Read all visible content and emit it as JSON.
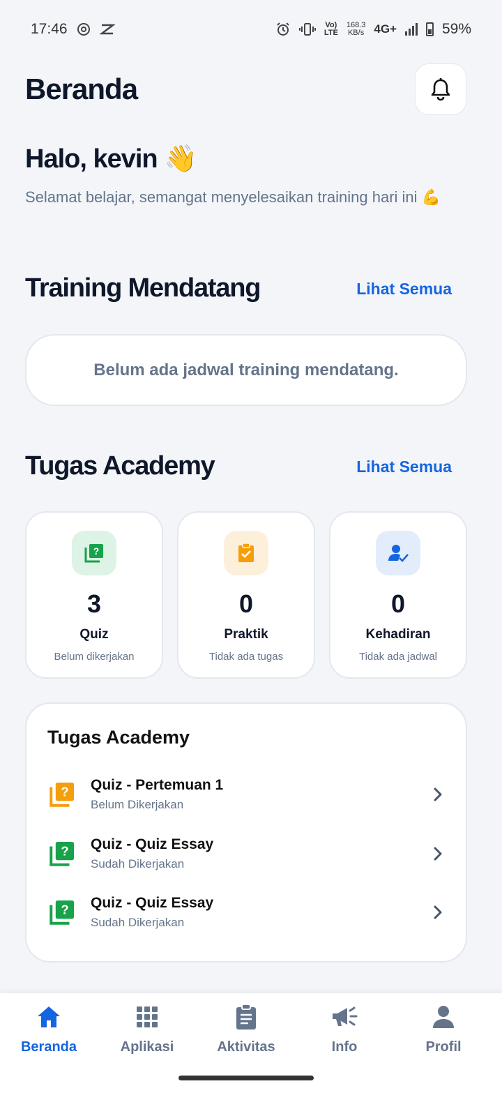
{
  "status_bar": {
    "time": "17:46",
    "volte_top": "Vo)",
    "volte_bottom": "LTE",
    "net_speed_value": "168.3",
    "net_speed_unit": "KB/s",
    "network": "4G+",
    "battery": "59%"
  },
  "header": {
    "title": "Beranda",
    "greeting": "Halo, kevin",
    "greeting_emoji": "👋",
    "subtitle": "Selamat belajar, semangat menyelesaikan training hari ini 💪"
  },
  "upcoming": {
    "title": "Training Mendatang",
    "see_all": "Lihat Semua",
    "empty_text": "Belum ada jadwal training mendatang."
  },
  "academy": {
    "title": "Tugas Academy",
    "see_all": "Lihat Semua",
    "stats": [
      {
        "count": "3",
        "label": "Quiz",
        "sub": "Belum dikerjakan",
        "icon": "quiz-icon",
        "color": "#16a34a",
        "bg": "#dcf3e5"
      },
      {
        "count": "0",
        "label": "Praktik",
        "sub": "Tidak ada tugas",
        "icon": "clipboard-check-icon",
        "color": "#f59e0b",
        "bg": "#fdf0db"
      },
      {
        "count": "0",
        "label": "Kehadiran",
        "sub": "Tidak ada jadwal",
        "icon": "person-check-icon",
        "color": "#1565e0",
        "bg": "#e3ecfb"
      }
    ]
  },
  "task_list": {
    "title": "Tugas Academy",
    "items": [
      {
        "name": "Quiz - Pertemuan 1",
        "status": "Belum Dikerjakan",
        "icon_color": "#f59e0b"
      },
      {
        "name": "Quiz - Quiz Essay",
        "status": "Sudah Dikerjakan",
        "icon_color": "#16a34a"
      },
      {
        "name": "Quiz - Quiz Essay",
        "status": "Sudah Dikerjakan",
        "icon_color": "#16a34a"
      }
    ]
  },
  "nav": {
    "items": [
      {
        "label": "Beranda",
        "icon": "home-icon"
      },
      {
        "label": "Aplikasi",
        "icon": "grid-icon"
      },
      {
        "label": "Aktivitas",
        "icon": "clipboard-icon"
      },
      {
        "label": "Info",
        "icon": "megaphone-icon"
      },
      {
        "label": "Profil",
        "icon": "person-icon"
      }
    ],
    "active": "Beranda"
  },
  "colors": {
    "accent": "#1565e0",
    "text": "#0f172a",
    "muted": "#64748b",
    "background": "#f3f5f9"
  }
}
